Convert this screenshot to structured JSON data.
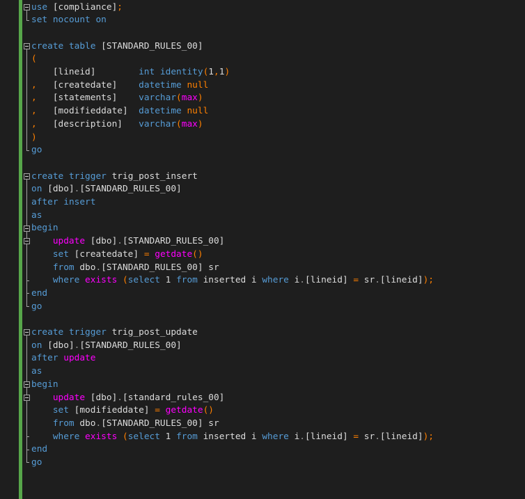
{
  "editor": {
    "lines": [
      [
        {
          "t": "use ",
          "c": "kw"
        },
        {
          "t": "[compliance]",
          "c": "id"
        },
        {
          "t": ";",
          "c": "op"
        }
      ],
      [
        {
          "t": "set ",
          "c": "kw"
        },
        {
          "t": "nocount ",
          "c": "kw"
        },
        {
          "t": "on",
          "c": "kw"
        }
      ],
      [],
      [
        {
          "t": "create ",
          "c": "kw"
        },
        {
          "t": "table ",
          "c": "kw"
        },
        {
          "t": "[STANDARD_RULES_00]",
          "c": "id"
        }
      ],
      [
        {
          "t": "(",
          "c": "op"
        }
      ],
      [
        {
          "t": "    [lineid]        ",
          "c": "id"
        },
        {
          "t": "int ",
          "c": "type"
        },
        {
          "t": "identity",
          "c": "kw"
        },
        {
          "t": "(",
          "c": "op"
        },
        {
          "t": "1",
          "c": "num"
        },
        {
          "t": ",",
          "c": "op"
        },
        {
          "t": "1",
          "c": "num"
        },
        {
          "t": ")",
          "c": "op"
        }
      ],
      [
        {
          "t": ",",
          "c": "op"
        },
        {
          "t": "   [createdate]    ",
          "c": "id"
        },
        {
          "t": "datetime ",
          "c": "type"
        },
        {
          "t": "null",
          "c": "op"
        }
      ],
      [
        {
          "t": ",",
          "c": "op"
        },
        {
          "t": "   [statements]    ",
          "c": "id"
        },
        {
          "t": "varchar",
          "c": "type"
        },
        {
          "t": "(",
          "c": "op"
        },
        {
          "t": "max",
          "c": "fn"
        },
        {
          "t": ")",
          "c": "op"
        }
      ],
      [
        {
          "t": ",",
          "c": "op"
        },
        {
          "t": "   [modifieddate]  ",
          "c": "id"
        },
        {
          "t": "datetime ",
          "c": "type"
        },
        {
          "t": "null",
          "c": "op"
        }
      ],
      [
        {
          "t": ",",
          "c": "op"
        },
        {
          "t": "   [description]   ",
          "c": "id"
        },
        {
          "t": "varchar",
          "c": "type"
        },
        {
          "t": "(",
          "c": "op"
        },
        {
          "t": "max",
          "c": "fn"
        },
        {
          "t": ")",
          "c": "op"
        }
      ],
      [
        {
          "t": ")",
          "c": "op"
        }
      ],
      [
        {
          "t": "go",
          "c": "kw"
        }
      ],
      [],
      [
        {
          "t": "create ",
          "c": "kw"
        },
        {
          "t": "trigger ",
          "c": "kw"
        },
        {
          "t": "trig_post_insert",
          "c": "id"
        }
      ],
      [
        {
          "t": "on ",
          "c": "kw"
        },
        {
          "t": "[dbo]",
          "c": "id"
        },
        {
          "t": ".",
          "c": "gray"
        },
        {
          "t": "[STANDARD_RULES_00]",
          "c": "id"
        }
      ],
      [
        {
          "t": "after ",
          "c": "kw"
        },
        {
          "t": "insert",
          "c": "kw"
        }
      ],
      [
        {
          "t": "as",
          "c": "kw"
        }
      ],
      [
        {
          "t": "begin",
          "c": "kw"
        }
      ],
      [
        {
          "t": "    update ",
          "c": "fn"
        },
        {
          "t": "[dbo]",
          "c": "id"
        },
        {
          "t": ".",
          "c": "gray"
        },
        {
          "t": "[STANDARD_RULES_00]",
          "c": "id"
        }
      ],
      [
        {
          "t": "    set ",
          "c": "kw"
        },
        {
          "t": "[createdate] ",
          "c": "id"
        },
        {
          "t": "= ",
          "c": "op"
        },
        {
          "t": "getdate",
          "c": "fn"
        },
        {
          "t": "()",
          "c": "op"
        }
      ],
      [
        {
          "t": "    from ",
          "c": "kw"
        },
        {
          "t": "dbo",
          "c": "id"
        },
        {
          "t": ".",
          "c": "gray"
        },
        {
          "t": "[STANDARD_RULES_00] sr",
          "c": "id"
        }
      ],
      [
        {
          "t": "    where ",
          "c": "kw"
        },
        {
          "t": "exists ",
          "c": "fn"
        },
        {
          "t": "(",
          "c": "op"
        },
        {
          "t": "select ",
          "c": "kw"
        },
        {
          "t": "1 ",
          "c": "num"
        },
        {
          "t": "from ",
          "c": "kw"
        },
        {
          "t": "inserted i ",
          "c": "id"
        },
        {
          "t": "where ",
          "c": "kw"
        },
        {
          "t": "i",
          "c": "id"
        },
        {
          "t": ".",
          "c": "gray"
        },
        {
          "t": "[lineid] ",
          "c": "id"
        },
        {
          "t": "= ",
          "c": "op"
        },
        {
          "t": "sr",
          "c": "id"
        },
        {
          "t": ".",
          "c": "gray"
        },
        {
          "t": "[lineid]",
          "c": "id"
        },
        {
          "t": ");",
          "c": "op"
        }
      ],
      [
        {
          "t": "end",
          "c": "kw"
        }
      ],
      [
        {
          "t": "go",
          "c": "kw"
        }
      ],
      [],
      [
        {
          "t": "create ",
          "c": "kw"
        },
        {
          "t": "trigger ",
          "c": "kw"
        },
        {
          "t": "trig_post_update",
          "c": "id"
        }
      ],
      [
        {
          "t": "on ",
          "c": "kw"
        },
        {
          "t": "[dbo]",
          "c": "id"
        },
        {
          "t": ".",
          "c": "gray"
        },
        {
          "t": "[STANDARD_RULES_00]",
          "c": "id"
        }
      ],
      [
        {
          "t": "after ",
          "c": "kw"
        },
        {
          "t": "update",
          "c": "fn"
        }
      ],
      [
        {
          "t": "as",
          "c": "kw"
        }
      ],
      [
        {
          "t": "begin",
          "c": "kw"
        }
      ],
      [
        {
          "t": "    update ",
          "c": "fn"
        },
        {
          "t": "[dbo]",
          "c": "id"
        },
        {
          "t": ".",
          "c": "gray"
        },
        {
          "t": "[standard_rules_00]",
          "c": "id"
        }
      ],
      [
        {
          "t": "    set ",
          "c": "kw"
        },
        {
          "t": "[modifieddate] ",
          "c": "id"
        },
        {
          "t": "= ",
          "c": "op"
        },
        {
          "t": "getdate",
          "c": "fn"
        },
        {
          "t": "()",
          "c": "op"
        }
      ],
      [
        {
          "t": "    from ",
          "c": "kw"
        },
        {
          "t": "dbo",
          "c": "id"
        },
        {
          "t": ".",
          "c": "gray"
        },
        {
          "t": "[STANDARD_RULES_00] sr",
          "c": "id"
        }
      ],
      [
        {
          "t": "    where ",
          "c": "kw"
        },
        {
          "t": "exists ",
          "c": "fn"
        },
        {
          "t": "(",
          "c": "op"
        },
        {
          "t": "select ",
          "c": "kw"
        },
        {
          "t": "1 ",
          "c": "num"
        },
        {
          "t": "from ",
          "c": "kw"
        },
        {
          "t": "inserted i ",
          "c": "id"
        },
        {
          "t": "where ",
          "c": "kw"
        },
        {
          "t": "i",
          "c": "id"
        },
        {
          "t": ".",
          "c": "gray"
        },
        {
          "t": "[lineid] ",
          "c": "id"
        },
        {
          "t": "= ",
          "c": "op"
        },
        {
          "t": "sr",
          "c": "id"
        },
        {
          "t": ".",
          "c": "gray"
        },
        {
          "t": "[lineid]",
          "c": "id"
        },
        {
          "t": ");",
          "c": "op"
        }
      ],
      [
        {
          "t": "end",
          "c": "kw"
        }
      ],
      [
        {
          "t": "go",
          "c": "kw"
        }
      ]
    ],
    "fold_regions": [
      {
        "start": 0,
        "end": 1
      },
      {
        "start": 3,
        "end": 11
      },
      {
        "start": 13,
        "end": 23
      },
      {
        "start": 17,
        "end": 22
      },
      {
        "start": 18,
        "end": 21
      },
      {
        "start": 25,
        "end": 35
      },
      {
        "start": 29,
        "end": 34
      },
      {
        "start": 30,
        "end": 33
      }
    ],
    "colors": {
      "background": "#1e1e1e",
      "keyword": "#569cd6",
      "function": "#ff00ff",
      "operator": "#ff8000",
      "identifier": "#dcdcdc",
      "change_bar": "#57a64a"
    }
  }
}
